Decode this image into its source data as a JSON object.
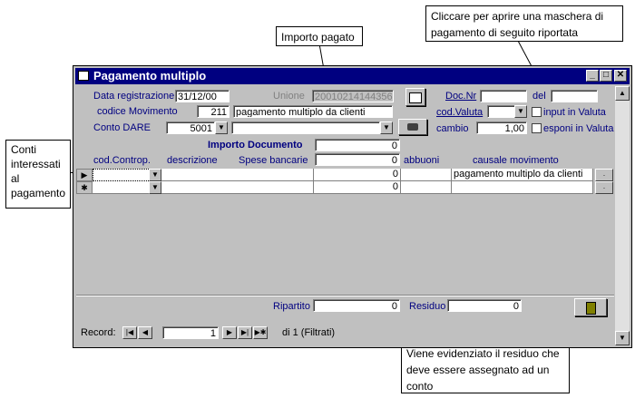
{
  "callouts": {
    "importo": "Importo pagato",
    "top_right": "Cliccare per aprire una maschera di pagamento di seguito riportata",
    "left": "Conti interessati al pagamento",
    "bottom": "Viene evidenziato il residuo che deve essere assegnato ad un conto"
  },
  "window": {
    "title": "Pagamento multiplo",
    "min": "_",
    "max": "□",
    "close": "✕"
  },
  "header": {
    "data_reg_label": "Data registrazione",
    "data_reg_value": "31/12/00",
    "unione_label": "Unione",
    "unione_value": "20010214144356",
    "doc_nr_label": "Doc.Nr",
    "doc_nr_value": "",
    "del_label": "del",
    "del_value": "",
    "codice_mov_label": "codice Movimento",
    "codice_mov_value": "211",
    "codice_mov_desc": "pagamento multiplo da clienti",
    "cod_valuta_label": "cod.Valuta",
    "cod_valuta_value": "",
    "input_valuta_label": "input   in Valuta",
    "conto_dare_label": "Conto DARE",
    "conto_dare_value": "5001",
    "conto_dare_desc": "",
    "cambio_label": "cambio",
    "cambio_value": "1,00",
    "esponi_valuta_label": "esponi in Valuta",
    "importo_doc_label": "Importo Documento",
    "importo_doc_value": "0"
  },
  "detail": {
    "columns": {
      "cod_controp": "cod.Controp.",
      "descrizione": "descrizione",
      "spese_bancarie": "Spese bancarie",
      "abbuoni": "abbuoni",
      "causale": "causale movimento"
    },
    "spese_header_value": "0",
    "rows": [
      {
        "selector": "▶",
        "cod": "",
        "desc": "",
        "importo": "0",
        "abbuoni": "",
        "causale": "pagamento multiplo da clienti"
      },
      {
        "selector": "✱",
        "cod": "",
        "desc": "",
        "importo": "0",
        "abbuoni": "",
        "causale": ""
      }
    ]
  },
  "footer": {
    "ripartito_label": "Ripartito",
    "ripartito_value": "0",
    "residuo_label": "Residuo",
    "residuo_value": "0"
  },
  "nav": {
    "record_label": "Record:",
    "current": "1",
    "total_text": "di 1 (Filtrati)"
  },
  "icons": [
    "form-icon",
    "printer-icon",
    "camera-icon",
    "exit-door-icon"
  ]
}
